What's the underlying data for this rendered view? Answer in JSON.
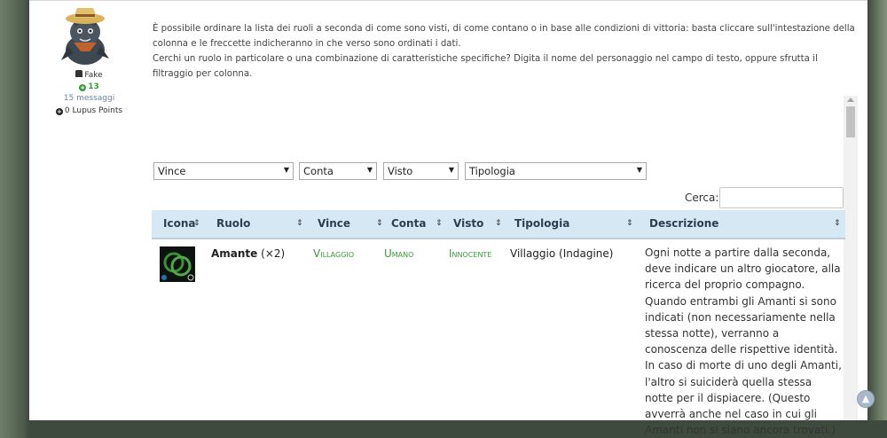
{
  "user": {
    "name": "Fake",
    "reputation": "13",
    "posts": "15 messaggi",
    "points": "0 Lupus Points"
  },
  "intro": {
    "p1": "È possibile ordinare la lista dei ruoli a seconda di come sono visti, di come contano o in base alle condizioni di vittoria: basta cliccare sull'intestazione della colonna e le freccette indicheranno in che verso sono ordinati i dati.",
    "p2": "Cerchi un ruolo  in particolare o una combinazione di caratteristiche specifiche? Digita il nome del personaggio nel campo di testo, oppure sfrutta il filtraggio per colonna."
  },
  "filters": {
    "vince": "Vince",
    "conta": "Conta",
    "visto": "Visto",
    "tipologia": "Tipologia"
  },
  "search": {
    "label": "Cerca:",
    "value": ""
  },
  "table": {
    "headers": [
      "Icona",
      "Ruolo",
      "Vince",
      "Conta",
      "Visto",
      "Tipologia",
      "Descrizione"
    ],
    "rows": [
      {
        "ruolo": "Amante",
        "count": "(×2)",
        "vince": "Villaggio",
        "conta": "Umano",
        "visto": "Innocente",
        "tipologia": "Villaggio (Indagine)",
        "descrizione": "Ogni notte a partire dalla seconda, deve indicare un altro giocatore, alla ricerca del proprio compagno. Quando entrambi gli Amanti si sono indicati (non necessariamente nella stessa notte), verranno a conoscenza delle rispettive identità. In caso di morte di uno degli Amanti, l'altro si suiciderà quella stessa notte per il dispiacere. (Questo avverrà anche nel caso in cui gli Amanti non si siano ancora trovati.)"
      }
    ]
  },
  "colors": {
    "accent_green": "#3c9a3c",
    "header_bg": "#d7e8f5"
  },
  "icons": [
    "lock-icon",
    "plus-circle-icon",
    "caret-down-icon",
    "sort-icon",
    "scroll-top-icon"
  ]
}
